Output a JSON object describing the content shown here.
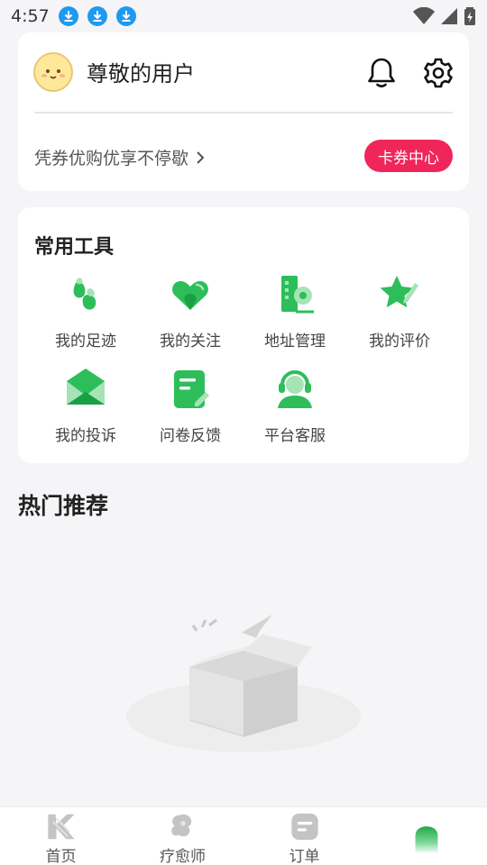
{
  "status_bar": {
    "time": "4:57"
  },
  "user": {
    "name": "尊敬的用户",
    "coupon_text": "凭券优购优享不停歇",
    "coupon_center_label": "卡券中心"
  },
  "tools": {
    "title": "常用工具",
    "items": [
      {
        "label": "我的足迹",
        "icon": "footprint-icon"
      },
      {
        "label": "我的关注",
        "icon": "heart-icon"
      },
      {
        "label": "地址管理",
        "icon": "address-icon"
      },
      {
        "label": "我的评价",
        "icon": "review-star-icon"
      },
      {
        "label": "我的投诉",
        "icon": "complaint-envelope-icon"
      },
      {
        "label": "问卷反馈",
        "icon": "survey-note-icon"
      },
      {
        "label": "平台客服",
        "icon": "customer-service-icon"
      }
    ]
  },
  "hot": {
    "title": "热门推荐"
  },
  "tab_bar": {
    "tabs": [
      {
        "label": "首页",
        "icon": "home-logo-icon"
      },
      {
        "label": "疗愈师",
        "icon": "therapist-icon"
      },
      {
        "label": "订单",
        "icon": "order-icon"
      },
      {
        "label": "",
        "icon": "mine-icon"
      }
    ]
  },
  "colors": {
    "accent_green": "#2dbe5a",
    "coupon_red": "#f0265a",
    "download_blue": "#1e9bf0"
  }
}
